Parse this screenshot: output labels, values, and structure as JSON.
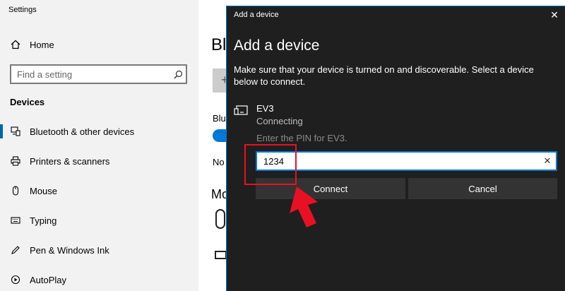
{
  "settings": {
    "app_title": "Settings",
    "home_label": "Home",
    "search_placeholder": "Find a setting",
    "section_heading": "Devices",
    "nav_items": [
      {
        "label": "Bluetooth & other devices",
        "icon": "bluetooth-devices-icon",
        "selected": true
      },
      {
        "label": "Printers & scanners",
        "icon": "printer-icon",
        "selected": false
      },
      {
        "label": "Mouse",
        "icon": "mouse-icon",
        "selected": false
      },
      {
        "label": "Typing",
        "icon": "keyboard-icon",
        "selected": false
      },
      {
        "label": "Pen & Windows Ink",
        "icon": "pen-icon",
        "selected": false
      },
      {
        "label": "AutoPlay",
        "icon": "autoplay-icon",
        "selected": false
      }
    ]
  },
  "main": {
    "title_partial": "Bl",
    "add_glyph": "+",
    "label1_partial": "Blu",
    "label2_partial": "No",
    "heading2_partial": "Mo"
  },
  "dialog": {
    "window_title": "Add a device",
    "close_glyph": "✕",
    "heading": "Add a device",
    "description": "Make sure that your device is turned on and discoverable. Select a device below to connect.",
    "device_name": "EV3",
    "device_status": "Connecting",
    "pin_prompt": "Enter the PIN for EV3.",
    "pin_value": "1234",
    "clear_glyph": "✕",
    "connect_label": "Connect",
    "cancel_label": "Cancel"
  },
  "colors": {
    "accent": "#0078d7",
    "dialog_bg": "#1f1f1f",
    "annotation": "#e81123"
  }
}
